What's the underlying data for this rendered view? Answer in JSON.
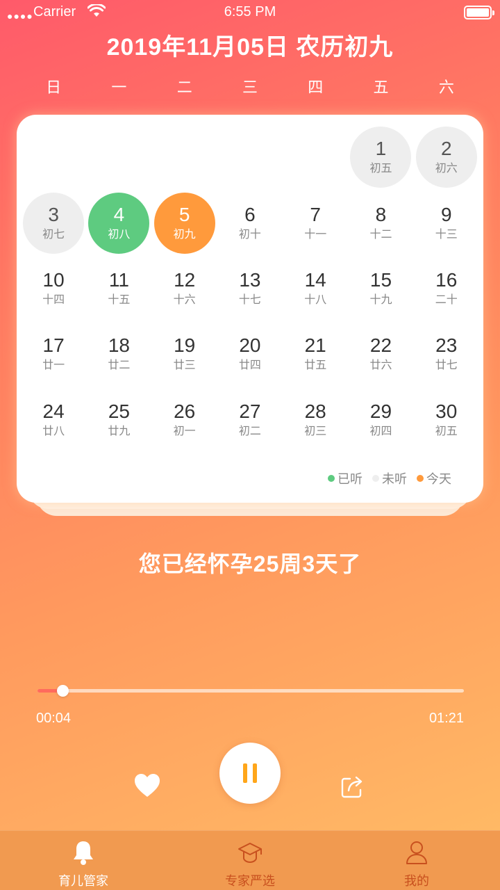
{
  "status_bar": {
    "carrier": "Carrier",
    "time": "6:55 PM"
  },
  "header": {
    "date_title": "2019年11月05日 农历初九"
  },
  "weekdays": [
    "日",
    "一",
    "二",
    "三",
    "四",
    "五",
    "六"
  ],
  "calendar": {
    "leading_blanks": 5,
    "days": [
      {
        "num": "1",
        "lunar": "初五",
        "state": "unheard"
      },
      {
        "num": "2",
        "lunar": "初六",
        "state": "unheard"
      },
      {
        "num": "3",
        "lunar": "初七",
        "state": "unheard"
      },
      {
        "num": "4",
        "lunar": "初八",
        "state": "heard"
      },
      {
        "num": "5",
        "lunar": "初九",
        "state": "today"
      },
      {
        "num": "6",
        "lunar": "初十",
        "state": ""
      },
      {
        "num": "7",
        "lunar": "十一",
        "state": ""
      },
      {
        "num": "8",
        "lunar": "十二",
        "state": ""
      },
      {
        "num": "9",
        "lunar": "十三",
        "state": ""
      },
      {
        "num": "10",
        "lunar": "十四",
        "state": ""
      },
      {
        "num": "11",
        "lunar": "十五",
        "state": ""
      },
      {
        "num": "12",
        "lunar": "十六",
        "state": ""
      },
      {
        "num": "13",
        "lunar": "十七",
        "state": ""
      },
      {
        "num": "14",
        "lunar": "十八",
        "state": ""
      },
      {
        "num": "15",
        "lunar": "十九",
        "state": ""
      },
      {
        "num": "16",
        "lunar": "二十",
        "state": ""
      },
      {
        "num": "17",
        "lunar": "廿一",
        "state": ""
      },
      {
        "num": "18",
        "lunar": "廿二",
        "state": ""
      },
      {
        "num": "19",
        "lunar": "廿三",
        "state": ""
      },
      {
        "num": "20",
        "lunar": "廿四",
        "state": ""
      },
      {
        "num": "21",
        "lunar": "廿五",
        "state": ""
      },
      {
        "num": "22",
        "lunar": "廿六",
        "state": ""
      },
      {
        "num": "23",
        "lunar": "廿七",
        "state": ""
      },
      {
        "num": "24",
        "lunar": "廿八",
        "state": ""
      },
      {
        "num": "25",
        "lunar": "廿九",
        "state": ""
      },
      {
        "num": "26",
        "lunar": "初一",
        "state": ""
      },
      {
        "num": "27",
        "lunar": "初二",
        "state": ""
      },
      {
        "num": "28",
        "lunar": "初三",
        "state": ""
      },
      {
        "num": "29",
        "lunar": "初四",
        "state": ""
      },
      {
        "num": "30",
        "lunar": "初五",
        "state": ""
      }
    ],
    "legend": [
      {
        "label": "已听",
        "color": "#5ecb80"
      },
      {
        "label": "未听",
        "color": "#eeeeee"
      },
      {
        "label": "今天",
        "color": "#ff9a3c"
      }
    ]
  },
  "pregnancy_text": "您已经怀孕25周3天了",
  "player": {
    "current_time": "00:04",
    "total_time": "01:21",
    "progress_fraction": 0.058,
    "state": "playing"
  },
  "tabs": [
    {
      "label": "育儿管家",
      "icon": "bell-icon",
      "active": true
    },
    {
      "label": "专家严选",
      "icon": "graduation-cap-icon",
      "active": false
    },
    {
      "label": "我的",
      "icon": "user-icon",
      "active": false
    }
  ],
  "colors": {
    "heard": "#5ecb80",
    "unheard": "#eeeeee",
    "today": "#ff9a3c",
    "pause_icon": "#ffa61a",
    "tab_bar": "#f19a50"
  }
}
